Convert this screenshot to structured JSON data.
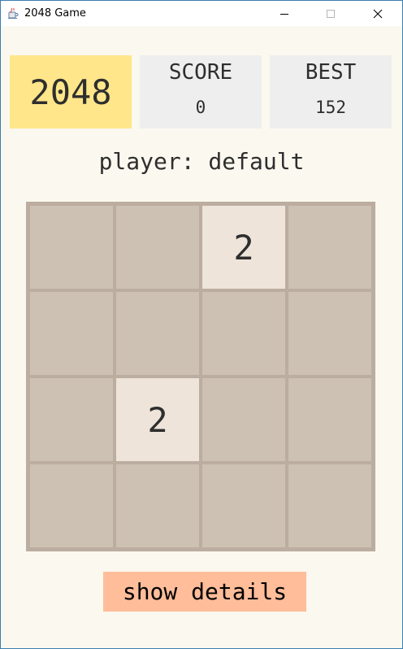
{
  "window": {
    "title": "2048 Game",
    "icon": "java-cup-icon"
  },
  "header": {
    "logo": "2048",
    "score_label": "SCORE",
    "score_value": "0",
    "best_label": "BEST",
    "best_value": "152"
  },
  "player": {
    "text": "player: default"
  },
  "board": {
    "size": 4,
    "grid": [
      [
        "",
        "",
        "2",
        ""
      ],
      [
        "",
        "",
        "",
        ""
      ],
      [
        "",
        "2",
        "",
        ""
      ],
      [
        "",
        "",
        "",
        ""
      ]
    ]
  },
  "actions": {
    "show_details": "show details"
  },
  "colors": {
    "background": "#fbf8ef",
    "board": "#bbada0",
    "empty_cell": "#cdc1b4",
    "tile_2": "#eee4da",
    "logo": "#ffe68a",
    "score_box": "#eeeeee",
    "button": "#ffbd9a"
  }
}
